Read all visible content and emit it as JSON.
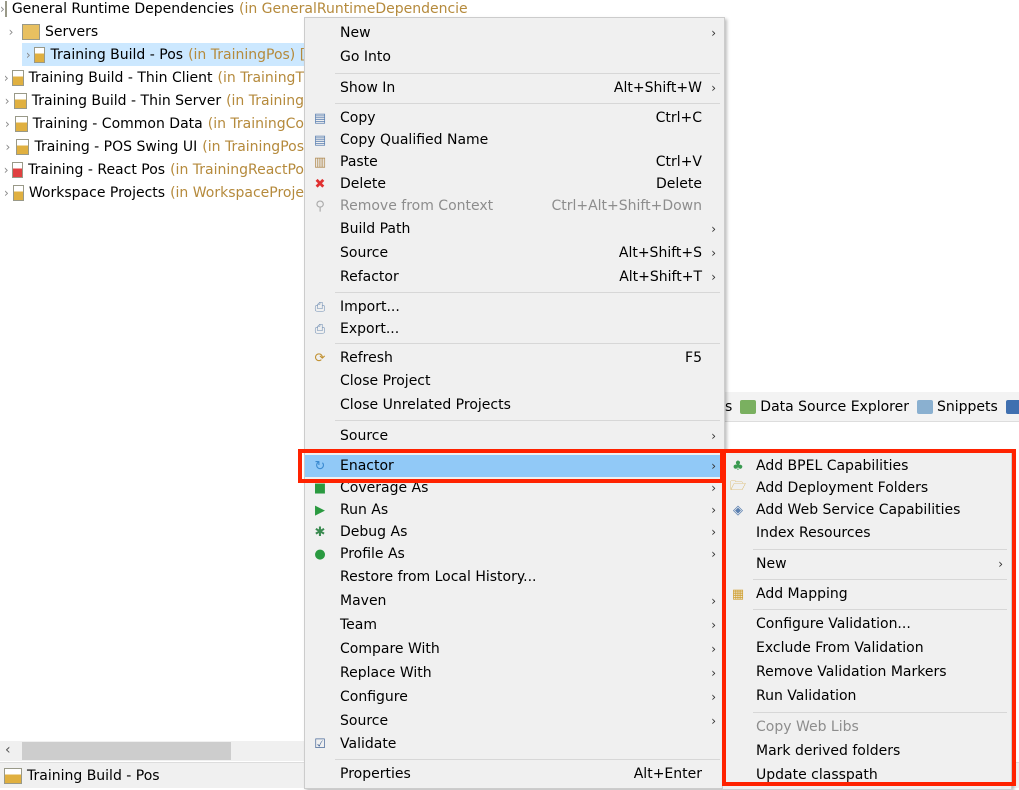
{
  "tree": {
    "items": [
      {
        "name": "General Runtime Dependencies",
        "deco": "(in GeneralRuntimeDependencie",
        "icon": "project-icon"
      },
      {
        "name": "Servers",
        "deco": "",
        "icon": "folder-icon"
      },
      {
        "name": "Training Build - Pos",
        "deco": "(in TrainingPos) [Tra",
        "icon": "maven-project-icon",
        "selected": true,
        "deco_dark": true
      },
      {
        "name": "Training Build - Thin Client",
        "deco": "(in TrainingT",
        "icon": "maven-project-icon"
      },
      {
        "name": "Training Build - Thin Server",
        "deco": "(in Training",
        "icon": "maven-project-icon"
      },
      {
        "name": "Training - Common Data",
        "deco": "(in TrainingCo",
        "icon": "maven-project-icon"
      },
      {
        "name": "Training - POS Swing UI",
        "deco": "(in TrainingPos",
        "icon": "maven-project-icon"
      },
      {
        "name": "Training - React Pos",
        "deco": "(in TrainingReactPo",
        "icon": "maven-project-error-icon"
      },
      {
        "name": "Workspace Projects",
        "deco": "(in WorkspaceProje",
        "icon": "maven-project-icon"
      }
    ]
  },
  "status_bar": {
    "label": "Training Build - Pos"
  },
  "view_tabs": [
    {
      "label": "s",
      "icon": ""
    },
    {
      "label": "Data Source Explorer",
      "icon": "data-source-icon"
    },
    {
      "label": "Snippets",
      "icon": "snippets-icon"
    },
    {
      "label": "T",
      "icon": "terminal-icon"
    }
  ],
  "context_menu": {
    "items": [
      {
        "label": "New",
        "submenu": true
      },
      {
        "label": "Go Into"
      },
      {
        "sep": true
      },
      {
        "label": "Show In",
        "shortcut": "Alt+Shift+W",
        "submenu": true
      },
      {
        "sep": true
      },
      {
        "label": "Copy",
        "shortcut": "Ctrl+C",
        "icon": "copy-icon"
      },
      {
        "label": "Copy Qualified Name",
        "icon": "copy-qualified-name-icon"
      },
      {
        "label": "Paste",
        "shortcut": "Ctrl+V",
        "icon": "paste-icon"
      },
      {
        "label": "Delete",
        "shortcut": "Delete",
        "icon": "delete-icon"
      },
      {
        "label": "Remove from Context",
        "shortcut": "Ctrl+Alt+Shift+Down",
        "icon": "remove-context-icon",
        "disabled": true
      },
      {
        "label": "Build Path",
        "submenu": true
      },
      {
        "label": "Source",
        "shortcut": "Alt+Shift+S",
        "submenu": true
      },
      {
        "label": "Refactor",
        "shortcut": "Alt+Shift+T",
        "submenu": true
      },
      {
        "sep": true
      },
      {
        "label": "Import...",
        "icon": "import-icon"
      },
      {
        "label": "Export...",
        "icon": "export-icon"
      },
      {
        "sep": true
      },
      {
        "label": "Refresh",
        "shortcut": "F5",
        "icon": "refresh-icon"
      },
      {
        "label": "Close Project"
      },
      {
        "label": "Close Unrelated Projects"
      },
      {
        "sep": true
      },
      {
        "label": "Source",
        "submenu": true
      },
      {
        "sep": true
      },
      {
        "label": "Enactor",
        "submenu": true,
        "icon": "enactor-icon",
        "highlighted": true
      },
      {
        "label": "Coverage As",
        "submenu": true,
        "icon": "coverage-icon"
      },
      {
        "label": "Run As",
        "submenu": true,
        "icon": "run-icon"
      },
      {
        "label": "Debug As",
        "submenu": true,
        "icon": "debug-icon"
      },
      {
        "label": "Profile As",
        "submenu": true,
        "icon": "profile-icon"
      },
      {
        "label": "Restore from Local History..."
      },
      {
        "label": "Maven",
        "submenu": true
      },
      {
        "label": "Team",
        "submenu": true
      },
      {
        "label": "Compare With",
        "submenu": true
      },
      {
        "label": "Replace With",
        "submenu": true
      },
      {
        "label": "Configure",
        "submenu": true
      },
      {
        "label": "Source",
        "submenu": true
      },
      {
        "label": "Validate",
        "icon": "checkbox-checked-icon"
      },
      {
        "sep": true
      },
      {
        "label": "Properties",
        "shortcut": "Alt+Enter"
      }
    ]
  },
  "enactor_submenu": {
    "items": [
      {
        "label": "Add BPEL Capabilities",
        "icon": "bpel-icon"
      },
      {
        "label": "Add Deployment Folders",
        "icon": "folder-add-icon"
      },
      {
        "label": "Add Web Service Capabilities",
        "icon": "web-service-icon"
      },
      {
        "label": "Index Resources"
      },
      {
        "sep": true
      },
      {
        "label": "New",
        "submenu": true
      },
      {
        "sep": true
      },
      {
        "label": "Add Mapping",
        "icon": "mapping-icon"
      },
      {
        "sep": true
      },
      {
        "label": "Configure Validation..."
      },
      {
        "label": "Exclude From Validation"
      },
      {
        "label": "Remove Validation Markers"
      },
      {
        "label": "Run Validation"
      },
      {
        "sep": true
      },
      {
        "label": "Copy Web Libs",
        "disabled": true
      },
      {
        "label": "Mark derived folders"
      },
      {
        "label": "Update classpath"
      }
    ]
  },
  "colors": {
    "highlight": "#91c9f7",
    "annotation_box": "#ff2200",
    "selection": "#cce8ff",
    "decoration": "#b58a3c"
  }
}
